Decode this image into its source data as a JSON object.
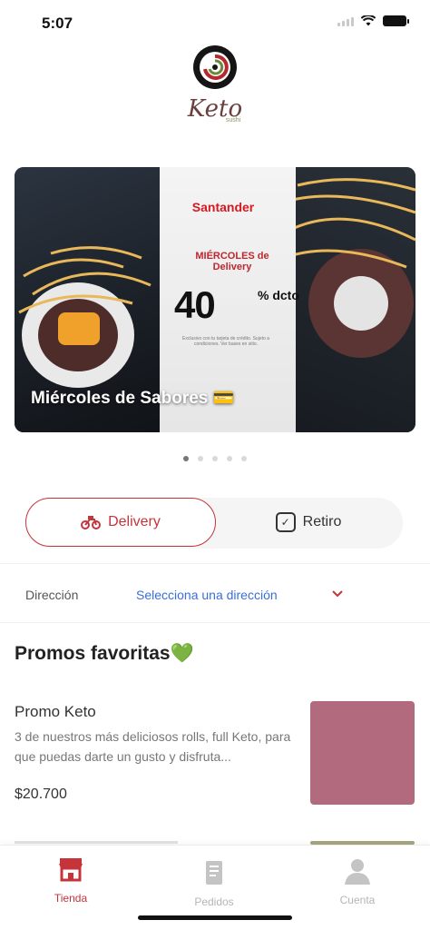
{
  "status": {
    "time": "5:07"
  },
  "brand": {
    "logo_text": "Keto",
    "logo_sub": "sushi"
  },
  "banner": {
    "title": "Miércoles de Sabores 💳",
    "sponsor": "Santander",
    "day": "MIÉRCOLES de Delivery",
    "discount": "40",
    "discount_suffix": "% dcto",
    "fine_print": "Exclusivo con tu tarjeta de crédito. Sujeto a condiciones. Ver bases en sitio."
  },
  "carousel": {
    "total": 5,
    "active": 0
  },
  "mode_toggle": {
    "delivery_label": "Delivery",
    "pickup_label": "Retiro"
  },
  "address": {
    "label": "Dirección",
    "placeholder": "Selecciona una dirección"
  },
  "section": {
    "title": "Promos favoritas💚"
  },
  "promos": [
    {
      "name": "Promo Keto",
      "description": "3 de nuestros más deliciosos rolls, full Keto, para que puedas darte un gusto y disfruta...",
      "price": "$20.700"
    }
  ],
  "tabs": [
    {
      "label": "Tienda",
      "active": true
    },
    {
      "label": "Pedidos",
      "active": false
    },
    {
      "label": "Cuenta",
      "active": false
    }
  ],
  "colors": {
    "accent": "#c6343b",
    "link": "#3a6fd8",
    "promo_thumb": "#b26a7e"
  }
}
